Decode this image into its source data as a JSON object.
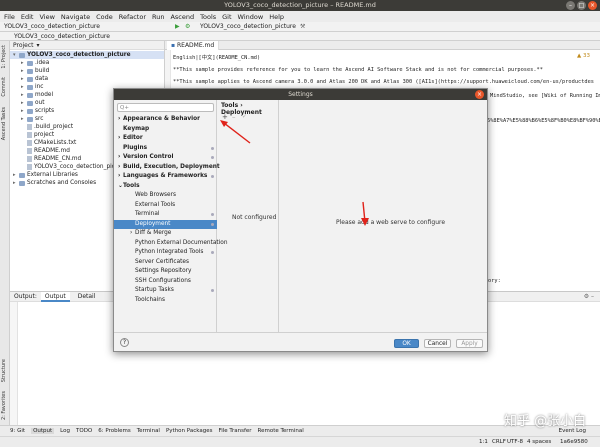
{
  "window": {
    "title": "YOLOV3_coco_detection_picture – README.md"
  },
  "menu": [
    "File",
    "Edit",
    "View",
    "Navigate",
    "Code",
    "Refactor",
    "Run",
    "Ascend",
    "Tools",
    "Git",
    "Window",
    "Help"
  ],
  "toolbar": {
    "crumb": "YOLOV3_coco_detection_picture",
    "config": "YOLOV3_coco_detection_picture"
  },
  "navbar": {
    "project_name": "YOLOV3_coco_detection_picture"
  },
  "left_strip": {
    "project": "1: Project",
    "commit": "Commit",
    "ascend": "Ascend Tasks",
    "structure": "Structure",
    "favorites": "2: Favorites"
  },
  "project_panel": {
    "header": "Project",
    "tree": [
      {
        "label": "YOLOV3_coco_detection_picture",
        "type": "folder",
        "indent": 0,
        "open": true
      },
      {
        "label": ".idea",
        "type": "folder",
        "indent": 1
      },
      {
        "label": "build",
        "type": "folder",
        "indent": 1
      },
      {
        "label": "data",
        "type": "folder",
        "indent": 1
      },
      {
        "label": "inc",
        "type": "folder",
        "indent": 1
      },
      {
        "label": "model",
        "type": "folder",
        "indent": 1
      },
      {
        "label": "out",
        "type": "folder",
        "indent": 1
      },
      {
        "label": "scripts",
        "type": "folder",
        "indent": 1
      },
      {
        "label": "src",
        "type": "folder",
        "indent": 1
      },
      {
        "label": ".build_project",
        "type": "file",
        "indent": 1
      },
      {
        "label": "project",
        "type": "file",
        "indent": 1
      },
      {
        "label": "CMakeLists.txt",
        "type": "file",
        "indent": 1
      },
      {
        "label": "README.md",
        "type": "file",
        "indent": 1
      },
      {
        "label": "README_CN.md",
        "type": "file",
        "indent": 1
      },
      {
        "label": "YOLOV3_coco_detection_picture",
        "type": "file",
        "indent": 1
      },
      {
        "label": "External Libraries",
        "type": "folder",
        "indent": 0
      },
      {
        "label": "Scratches and Consoles",
        "type": "folder",
        "indent": 0
      }
    ]
  },
  "editor": {
    "tab": "README.md",
    "lines": [
      "English|[中文](README_CN.md)",
      "",
      "**This sample provides reference for you to learn the Ascend AI Software Stack and is not for commercial purposes.**",
      "",
      "**This sample applies to Ascend camera 3.0.0 and Atlas 200 DK and Atlas 300 ([AI1s](https://support.huaweicloud.com/en-us/productdes"
    ],
    "right_fragment_1": "MindStudio, see [Wiki of Running Image Samp",
    "right_fragment_2": "6%8E%A7%E5%88%B6%E5%8F%B0%E8%BF%90%E8%A1%8C%E5%9B%BE%E7%89%87%E6%A0%B7%E4%BE%8B)",
    "right_fragment_3": "ory:",
    "warnings": "▲ 33"
  },
  "settings": {
    "title": "Settings",
    "search_placeholder": "Q+",
    "nav": [
      {
        "label": "Appearance & Behavior",
        "bold": true,
        "arrow": true
      },
      {
        "label": "Keymap",
        "bold": true
      },
      {
        "label": "Editor",
        "bold": true,
        "arrow": true
      },
      {
        "label": "Plugins",
        "bold": true,
        "dot": true
      },
      {
        "label": "Version Control",
        "bold": true,
        "arrow": true,
        "dot": true
      },
      {
        "label": "Build, Execution, Deployment",
        "bold": true,
        "arrow": true
      },
      {
        "label": "Languages & Frameworks",
        "bold": true,
        "arrow": true,
        "dot": true
      },
      {
        "label": "Tools",
        "bold": true,
        "open": true
      },
      {
        "label": "Web Browsers",
        "indent": true
      },
      {
        "label": "External Tools",
        "indent": true
      },
      {
        "label": "Terminal",
        "indent": true,
        "dot": true
      },
      {
        "label": "Deployment",
        "indent": true,
        "selected": true,
        "dot": true
      },
      {
        "label": "Diff & Merge",
        "indent": true,
        "arrow": true
      },
      {
        "label": "Python External Documentation",
        "indent": true
      },
      {
        "label": "Python Integrated Tools",
        "indent": true,
        "dot": true
      },
      {
        "label": "Server Certificates",
        "indent": true
      },
      {
        "label": "Settings Repository",
        "indent": true
      },
      {
        "label": "SSH Configurations",
        "indent": true
      },
      {
        "label": "Startup Tasks",
        "indent": true,
        "dot": true
      },
      {
        "label": "Toolchains",
        "indent": true
      }
    ],
    "breadcrumb": "Tools",
    "breadcrumb_sep": "›",
    "breadcrumb_page": "Deployment",
    "not_configured": "Not configured",
    "empty_message": "Please add a web serve to configure",
    "help": "?",
    "buttons": {
      "ok": "OK",
      "cancel": "Cancel",
      "apply": "Apply"
    }
  },
  "output_panel": {
    "tabs": [
      "Output",
      "Detail"
    ],
    "label": "Output:"
  },
  "tool_windows": [
    "9: Git",
    "Output",
    "Log",
    "TODO",
    "6: Problems",
    "Terminal",
    "Python Packages",
    "File Transfer",
    "Remote Terminal"
  ],
  "statusbar": {
    "position": "1:1",
    "line_ending": "CRLF",
    "encoding": "UTF-8",
    "indent": "4 spaces",
    "branch": "1a6e9580",
    "event_log": "Event Log"
  },
  "watermark": "知乎 @张小白",
  "colors": {
    "accent": "#4a88c7",
    "arrow": "#e0221a",
    "titlebar": "#3c3b37",
    "close": "#e8562a"
  }
}
